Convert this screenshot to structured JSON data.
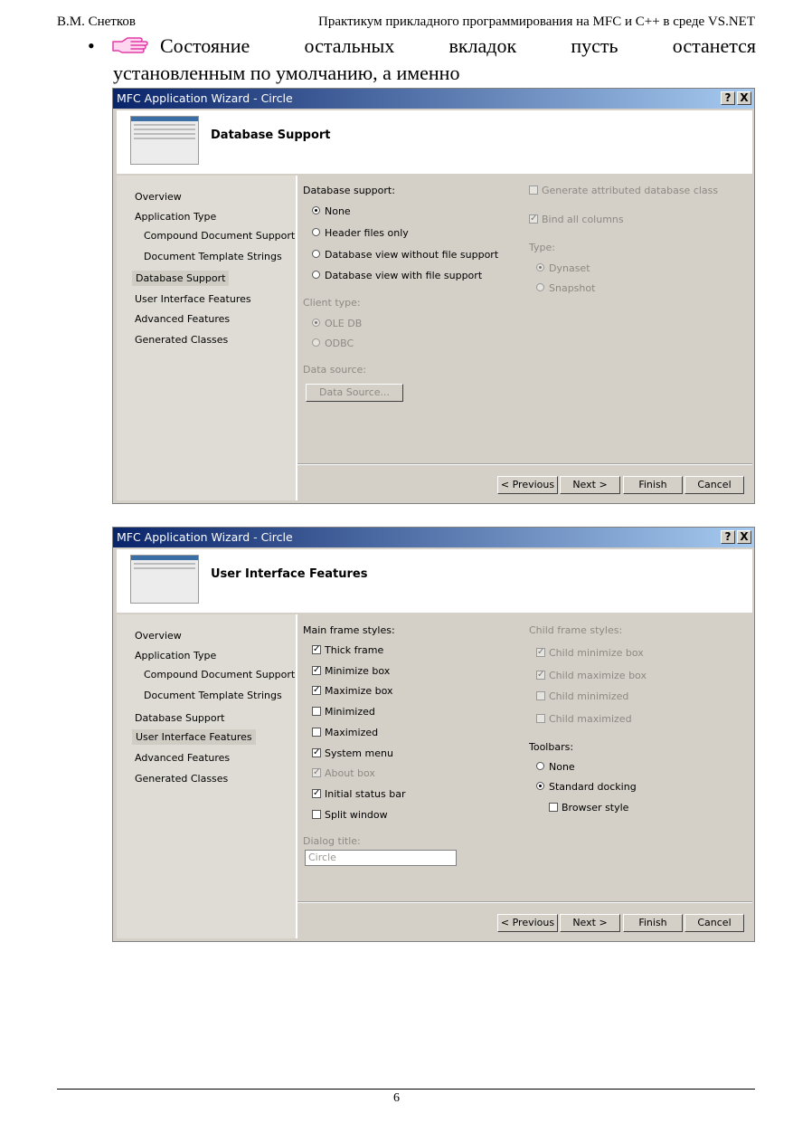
{
  "header": {
    "author": "В.М. Снетков",
    "course": "Практикум прикладного программирования на MFC и C++ в среде VS.NET"
  },
  "paragraph": {
    "bullet": "•",
    "line1_words": [
      "Состояние",
      "остальных",
      "вкладок",
      "пусть",
      "останется"
    ],
    "line2": "установленным по умолчанию, а именно"
  },
  "icons": {
    "bullet_icon": "pointing-hand-icon",
    "help_icon": "question-icon",
    "close_icon": "close-icon"
  },
  "nav_items": [
    "Overview",
    "Application Type",
    "Compound Document Support",
    "Document Template Strings",
    "Database Support",
    "User Interface Features",
    "Advanced Features",
    "Generated Classes"
  ],
  "buttons": {
    "previous": "< Previous",
    "next": "Next >",
    "finish": "Finish",
    "cancel": "Cancel",
    "help": "?",
    "close": "X"
  },
  "dialog1": {
    "title": "MFC Application Wizard - Circle",
    "heading": "Database Support",
    "selected_nav": "Database Support",
    "db_support_label": "Database support:",
    "db_options": [
      "None",
      "Header files only",
      "Database view without file support",
      "Database view with file support"
    ],
    "db_selected": "None",
    "client_type_label": "Client type:",
    "client_options": [
      "OLE DB",
      "ODBC"
    ],
    "client_selected": "OLE DB",
    "data_source_label": "Data source:",
    "data_source_button": "Data Source...",
    "generate_attributed": "Generate attributed database class",
    "bind_all": "Bind all columns",
    "type_label": "Type:",
    "type_options": [
      "Dynaset",
      "Snapshot"
    ],
    "type_selected": "Dynaset"
  },
  "dialog2": {
    "title": "MFC Application Wizard - Circle",
    "heading": "User Interface Features",
    "selected_nav": "User Interface Features",
    "main_frame_label": "Main frame styles:",
    "main_frame": [
      {
        "label": "Thick frame",
        "checked": true,
        "enabled": true
      },
      {
        "label": "Minimize box",
        "checked": true,
        "enabled": true
      },
      {
        "label": "Maximize box",
        "checked": true,
        "enabled": true
      },
      {
        "label": "Minimized",
        "checked": false,
        "enabled": true
      },
      {
        "label": "Maximized",
        "checked": false,
        "enabled": true
      },
      {
        "label": "System menu",
        "checked": true,
        "enabled": true
      },
      {
        "label": "About box",
        "checked": true,
        "enabled": false
      },
      {
        "label": "Initial status bar",
        "checked": true,
        "enabled": true
      },
      {
        "label": "Split window",
        "checked": false,
        "enabled": true
      }
    ],
    "dialog_title_label": "Dialog title:",
    "dialog_title_value": "Circle",
    "child_frame_label": "Child frame styles:",
    "child_frame": [
      {
        "label": "Child minimize box",
        "checked": true
      },
      {
        "label": "Child maximize box",
        "checked": true
      },
      {
        "label": "Child minimized",
        "checked": false
      },
      {
        "label": "Child maximized",
        "checked": false
      }
    ],
    "toolbars_label": "Toolbars:",
    "toolbar_options": [
      "None",
      "Standard docking"
    ],
    "toolbar_selected": "Standard docking",
    "browser_style": "Browser style"
  },
  "footer": {
    "page_number": "6"
  }
}
